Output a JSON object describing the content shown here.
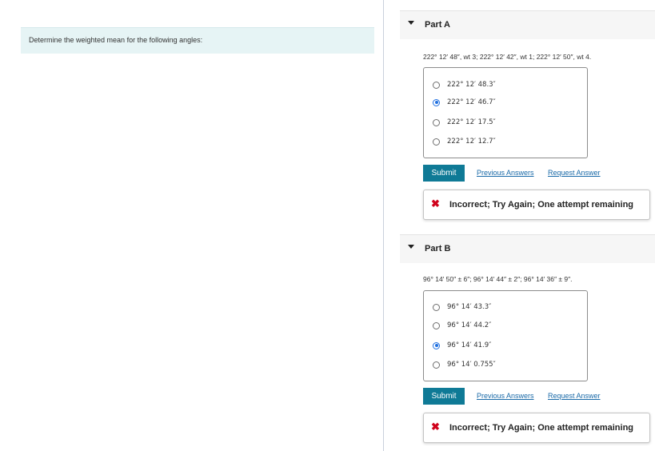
{
  "left_panel": {
    "prompt": "Determine the weighted mean for the following angles:"
  },
  "parts": [
    {
      "title": "Part A",
      "question": "222° 12′ 48″, wt 3; 222° 12′ 42″, wt 1; 222° 12′ 50″, wt 4.",
      "options": [
        "222° 12′ 48.3″",
        "222° 12′ 46.7″",
        "222° 12′ 17.5″",
        "222° 12′ 12.7″"
      ],
      "selected_index": 1,
      "submit_label": "Submit",
      "previous_answers_label": "Previous Answers",
      "request_answer_label": "Request Answer",
      "feedback": "Incorrect; Try Again; One attempt remaining"
    },
    {
      "title": "Part B",
      "question": "96° 14′ 50″ ± 6″; 96° 14′ 44″ ± 2″; 96° 14′ 36″ ± 9″.",
      "options": [
        "96° 14′ 43.3″",
        "96° 14′ 44.2″",
        "96° 14′ 41.9″",
        "96° 14′ 0.755″"
      ],
      "selected_index": 2,
      "submit_label": "Submit",
      "previous_answers_label": "Previous Answers",
      "request_answer_label": "Request Answer",
      "feedback": "Incorrect; Try Again; One attempt remaining"
    }
  ],
  "colors": {
    "accent": "#0f7a96",
    "error": "#d0021b",
    "link": "#1a6aa8",
    "banner": "#e6f4f5"
  }
}
